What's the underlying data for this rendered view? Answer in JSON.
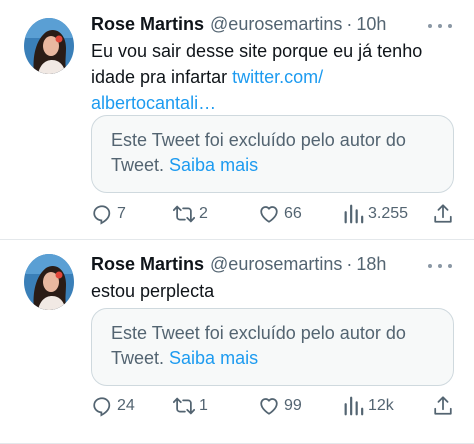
{
  "tweets": [
    {
      "author": "Rose Martins",
      "handle": "@eurosemartins",
      "separator": "·",
      "time": "10h",
      "text": "Eu vou sair desse site porque eu já tenho idade pra infartar ",
      "link": "twitter.com/ albertocantali…",
      "quote_text": "Este Tweet foi excluído pelo autor do Tweet. ",
      "quote_link": "Saiba mais",
      "replies": "7",
      "retweets": "2",
      "likes": "66",
      "views": "3.255"
    },
    {
      "author": "Rose Martins",
      "handle": "@eurosemartins",
      "separator": "·",
      "time": "18h",
      "text": "estou perplecta",
      "quote_text": "Este Tweet foi excluído pelo autor do Tweet. ",
      "quote_link": "Saiba mais",
      "replies": "24",
      "retweets": "1",
      "likes": "99",
      "views": "12k"
    }
  ],
  "icons": {
    "reply": "reply-icon",
    "retweet": "retweet-icon",
    "like": "heart-icon",
    "views": "views-chart-icon",
    "share": "share-icon",
    "more": "more-dots-icon"
  },
  "colors": {
    "link": "#1d9bf0",
    "secondary_text": "#536471",
    "primary_text": "#0f1419",
    "quote_bg": "#f7f9f9",
    "border": "#cfd9de"
  }
}
